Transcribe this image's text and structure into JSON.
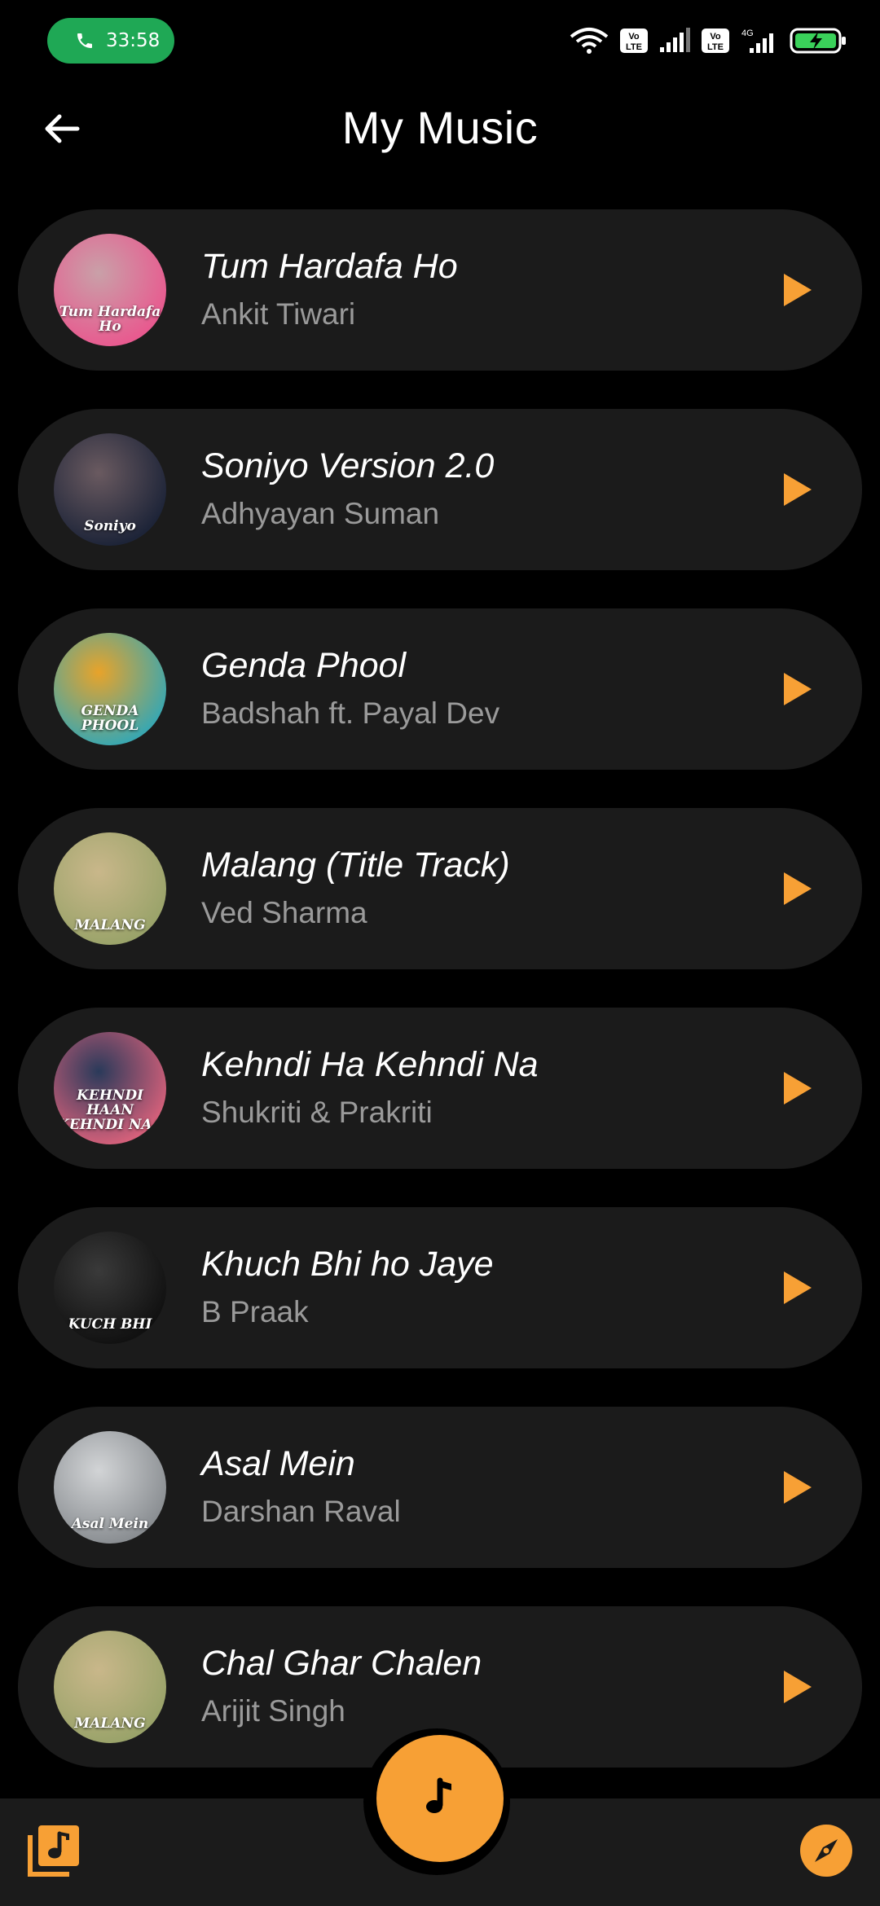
{
  "status_bar": {
    "call_timer": "33:58",
    "network_label_1": "Vo LTE",
    "network_label_2": "Vo LTE",
    "network_type": "4G"
  },
  "header": {
    "title": "My Music"
  },
  "songs": [
    {
      "title": "Tum Hardafa Ho",
      "artist": "Ankit Tiwari",
      "art_text": "Tum Hardafa Ho",
      "art_colors": [
        "#e85a8f",
        "#c9a0a8"
      ]
    },
    {
      "title": "Soniyo Version 2.0",
      "artist": "Adhyayan Suman",
      "art_text": "Soniyo",
      "art_colors": [
        "#1d2438",
        "#6a5a60"
      ]
    },
    {
      "title": "Genda Phool",
      "artist": "Badshah ft. Payal Dev",
      "art_text": "GENDA PHOOL",
      "art_colors": [
        "#3aa7b0",
        "#e8a32a"
      ]
    },
    {
      "title": "Malang (Title Track)",
      "artist": "Ved Sharma",
      "art_text": "MALANG",
      "art_colors": [
        "#9aa36a",
        "#c9b78a"
      ]
    },
    {
      "title": "Kehndi Ha Kehndi Na",
      "artist": "Shukriti & Prakriti",
      "art_text": "KEHNDI HAAN KEHNDI NAA",
      "art_colors": [
        "#d4607a",
        "#2a3a5a"
      ]
    },
    {
      "title": "Khuch Bhi ho Jaye",
      "artist": "B Praak",
      "art_text": "KUCH BHI",
      "art_colors": [
        "#111111",
        "#3a3a3a"
      ]
    },
    {
      "title": "Asal Mein",
      "artist": "Darshan Raval",
      "art_text": "Asal Mein",
      "art_colors": [
        "#8a8e92",
        "#d2d4d6"
      ]
    },
    {
      "title": "Chal Ghar Chalen",
      "artist": "Arijit Singh",
      "art_text": "MALANG",
      "art_colors": [
        "#9aa36a",
        "#c9b78a"
      ]
    }
  ],
  "icons": {
    "back": "arrow-left-icon",
    "play": "play-icon",
    "fab": "music-note-icon",
    "library": "music-library-icon",
    "explore": "compass-icon"
  },
  "colors": {
    "accent": "#f7a035",
    "card_bg": "#1b1b1b",
    "artist_text": "#9a9a9a",
    "call_pill": "#1fa855"
  }
}
